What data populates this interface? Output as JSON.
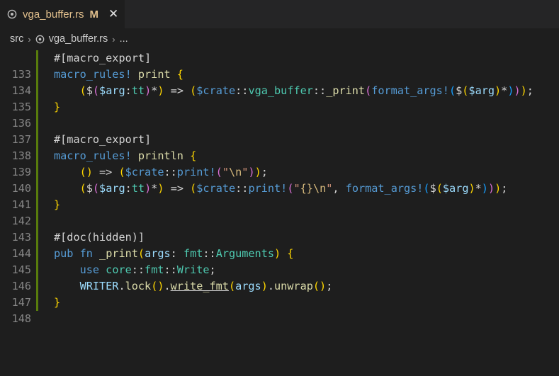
{
  "tab": {
    "filename": "vga_buffer.rs",
    "modified_flag": "M",
    "close_glyph": "✕",
    "icon": "rust-file-icon"
  },
  "breadcrumb": {
    "items": [
      "src",
      "vga_buffer.rs",
      "..."
    ],
    "separator": "›"
  },
  "editor": {
    "line_numbers": [
      "133",
      "134",
      "135",
      "136",
      "137",
      "138",
      "139",
      "140",
      "141",
      "142",
      "143",
      "144",
      "145",
      "146",
      "147",
      "148"
    ],
    "lines": [
      "#[macro_export]",
      "macro_rules! print {",
      "    ($($arg:tt)*) => ($crate::vga_buffer::_print(format_args!($($arg)*)));",
      "}",
      "",
      "#[macro_export]",
      "macro_rules! println {",
      "    () => ($crate::print!(\"\\n\"));",
      "    ($($arg:tt)*) => ($crate::print!(\"{}\\n\", format_args!($($arg)*)));",
      "}",
      "",
      "#[doc(hidden)]",
      "pub fn _print(args: fmt::Arguments) {",
      "    use core::fmt::Write;",
      "    WRITER.lock().write_fmt(args).unwrap();",
      "}"
    ]
  },
  "colors": {
    "background": "#1e1e1e",
    "tab_label": "#e2c08d",
    "line_number": "#858585",
    "gutter_added": "#2ea043"
  }
}
